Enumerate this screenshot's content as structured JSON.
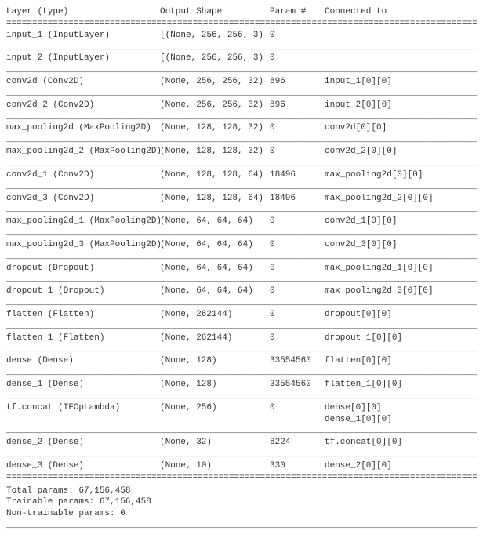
{
  "header": {
    "layer": "Layer (type)",
    "shape": "Output Shape",
    "param": "Param #",
    "connected": "Connected to"
  },
  "rows": [
    {
      "layer": "input_1 (InputLayer)",
      "shape": "[(None, 256, 256, 3)",
      "param": "0",
      "connected": []
    },
    {
      "layer": "input_2 (InputLayer)",
      "shape": "[(None, 256, 256, 3)",
      "param": "0",
      "connected": []
    },
    {
      "layer": "conv2d (Conv2D)",
      "shape": "(None, 256, 256, 32)",
      "param": "896",
      "connected": [
        "input_1[0][0]"
      ]
    },
    {
      "layer": "conv2d_2 (Conv2D)",
      "shape": "(None, 256, 256, 32)",
      "param": "896",
      "connected": [
        "input_2[0][0]"
      ]
    },
    {
      "layer": "max_pooling2d (MaxPooling2D)",
      "shape": "(None, 128, 128, 32)",
      "param": "0",
      "connected": [
        "conv2d[0][0]"
      ]
    },
    {
      "layer": "max_pooling2d_2 (MaxPooling2D)",
      "shape": "(None, 128, 128, 32)",
      "param": "0",
      "connected": [
        "conv2d_2[0][0]"
      ]
    },
    {
      "layer": "conv2d_1 (Conv2D)",
      "shape": "(None, 128, 128, 64)",
      "param": "18496",
      "connected": [
        "max_pooling2d[0][0]"
      ]
    },
    {
      "layer": "conv2d_3 (Conv2D)",
      "shape": "(None, 128, 128, 64)",
      "param": "18496",
      "connected": [
        "max_pooling2d_2[0][0]"
      ]
    },
    {
      "layer": "max_pooling2d_1 (MaxPooling2D)",
      "shape": "(None, 64, 64, 64)",
      "param": "0",
      "connected": [
        "conv2d_1[0][0]"
      ]
    },
    {
      "layer": "max_pooling2d_3 (MaxPooling2D)",
      "shape": "(None, 64, 64, 64)",
      "param": "0",
      "connected": [
        "conv2d_3[0][0]"
      ]
    },
    {
      "layer": "dropout (Dropout)",
      "shape": "(None, 64, 64, 64)",
      "param": "0",
      "connected": [
        "max_pooling2d_1[0][0]"
      ]
    },
    {
      "layer": "dropout_1 (Dropout)",
      "shape": "(None, 64, 64, 64)",
      "param": "0",
      "connected": [
        "max_pooling2d_3[0][0]"
      ]
    },
    {
      "layer": "flatten (Flatten)",
      "shape": "(None, 262144)",
      "param": "0",
      "connected": [
        "dropout[0][0]"
      ]
    },
    {
      "layer": "flatten_1 (Flatten)",
      "shape": "(None, 262144)",
      "param": "0",
      "connected": [
        "dropout_1[0][0]"
      ]
    },
    {
      "layer": "dense (Dense)",
      "shape": "(None, 128)",
      "param": "33554560",
      "connected": [
        "flatten[0][0]"
      ]
    },
    {
      "layer": "dense_1 (Dense)",
      "shape": "(None, 128)",
      "param": "33554560",
      "connected": [
        "flatten_1[0][0]"
      ]
    },
    {
      "layer": "tf.concat (TFOpLambda)",
      "shape": "(None, 256)",
      "param": "0",
      "connected": [
        "dense[0][0]",
        "dense_1[0][0]"
      ]
    },
    {
      "layer": "dense_2 (Dense)",
      "shape": "(None, 32)",
      "param": "8224",
      "connected": [
        "tf.concat[0][0]"
      ]
    },
    {
      "layer": "dense_3 (Dense)",
      "shape": "(None, 10)",
      "param": "330",
      "connected": [
        "dense_2[0][0]"
      ]
    }
  ],
  "footer": {
    "total": "Total params: 67,156,458",
    "trainable": "Trainable params: 67,156,458",
    "nontrainable": "Non-trainable params: 0"
  }
}
